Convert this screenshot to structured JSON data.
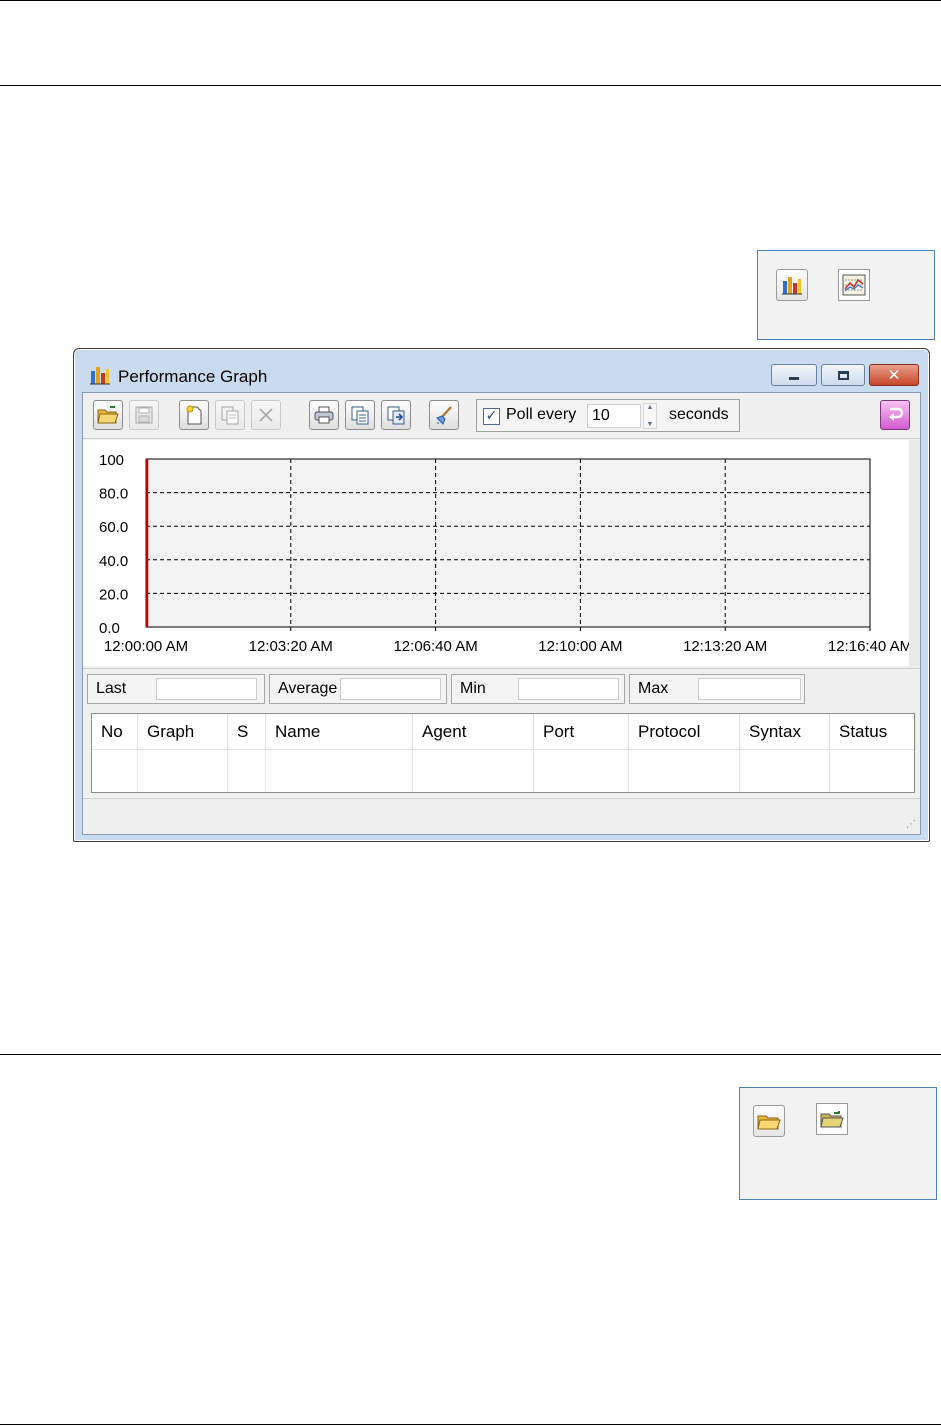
{
  "window": {
    "title": "Performance Graph",
    "icon": "bar-chart-icon",
    "controls": [
      "minimize-icon",
      "maximize-icon",
      "close-icon"
    ]
  },
  "toolbar": {
    "buttons": [
      "open-folder-icon",
      "save-icon",
      "new-icon",
      "copy-template-icon",
      "delete-icon",
      "print-icon",
      "copy-icon",
      "paste-icon",
      "clear-icon"
    ],
    "poll": {
      "checked": true,
      "label": "Poll every",
      "value": "10",
      "unit": "seconds"
    },
    "right_button": "return-icon"
  },
  "chart_data": {
    "type": "line",
    "title": "",
    "xlabel": "",
    "ylabel": "",
    "ylim": [
      0,
      100
    ],
    "yticks": [
      "100",
      "80.0",
      "60.0",
      "40.0",
      "20.0",
      "0.0"
    ],
    "xticks": [
      "12:00:00 AM",
      "12:03:20 AM",
      "12:06:40 AM",
      "12:10:00 AM",
      "12:13:20 AM",
      "12:16:40 AM"
    ],
    "grid": true,
    "series": [],
    "cursor_x": "12:00:00 AM",
    "cursor_color": "#c00000"
  },
  "stats": {
    "last_label": "Last",
    "average_label": "Average",
    "min_label": "Min",
    "max_label": "Max"
  },
  "table": {
    "columns": [
      "No",
      "Graph",
      "S",
      "Name",
      "Agent",
      "Port",
      "Protocol",
      "Syntax",
      "Status"
    ],
    "rows": []
  },
  "icon_legend_top": [
    "performance-graph-icon",
    "line-graph-icon"
  ],
  "icon_legend_bottom": [
    "open-folder-icon",
    "open-folder-alt-icon"
  ],
  "colors": {
    "accent_border": "#4f81bd",
    "close_button": "#c8462a",
    "cursor": "#c00000"
  }
}
